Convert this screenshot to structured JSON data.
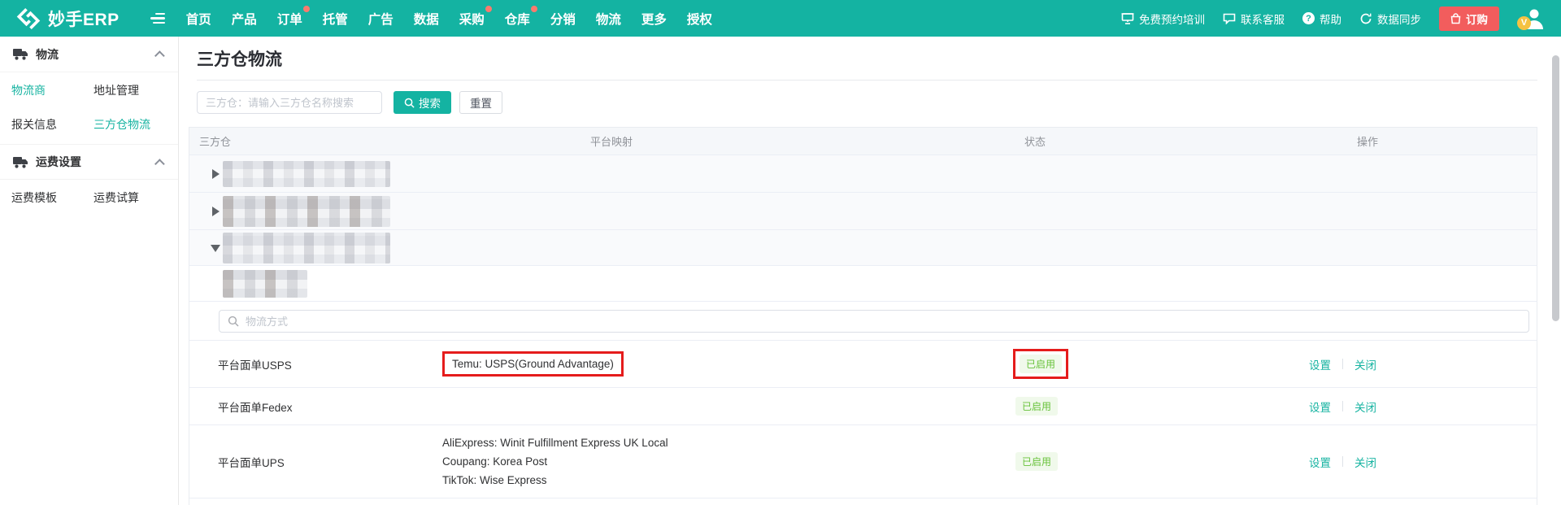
{
  "brand": {
    "name": "妙手ERP"
  },
  "topnav": {
    "items": [
      {
        "label": "首页",
        "dot": false
      },
      {
        "label": "产品",
        "dot": false
      },
      {
        "label": "订单",
        "dot": true
      },
      {
        "label": "托管",
        "dot": false
      },
      {
        "label": "广告",
        "dot": false
      },
      {
        "label": "数据",
        "dot": false
      },
      {
        "label": "采购",
        "dot": true
      },
      {
        "label": "仓库",
        "dot": true
      },
      {
        "label": "分销",
        "dot": false
      },
      {
        "label": "物流",
        "dot": false
      },
      {
        "label": "更多",
        "dot": false
      },
      {
        "label": "授权",
        "dot": false
      }
    ]
  },
  "header_right": {
    "training": "免费预约培训",
    "support": "联系客服",
    "help": "帮助",
    "sync": "数据同步",
    "order": "订购",
    "avatar_badge": "V"
  },
  "sidebar": {
    "sections": [
      {
        "title": "物流",
        "items": [
          {
            "label": "物流商",
            "active": true
          },
          {
            "label": "地址管理",
            "active": false
          },
          {
            "label": "报关信息",
            "active": false
          },
          {
            "label": "三方仓物流",
            "active": true
          }
        ]
      },
      {
        "title": "运费设置",
        "items": [
          {
            "label": "运费模板",
            "active": false
          },
          {
            "label": "运费试算",
            "active": false
          }
        ]
      }
    ]
  },
  "main": {
    "title": "三方仓物流",
    "filter": {
      "placeholder": "三方仓：请输入三方仓名称搜索",
      "search": "搜索",
      "reset": "重置"
    },
    "table": {
      "columns": [
        "三方仓",
        "平台映射",
        "状态",
        "操作"
      ],
      "inner_search_placeholder": "物流方式",
      "rows": [
        {
          "name": "平台面单USPS",
          "mappings": [
            "Temu: USPS(Ground Advantage)"
          ],
          "status": "已启用",
          "actions": [
            "设置",
            "关闭"
          ],
          "highlighted": true
        },
        {
          "name": "平台面单Fedex",
          "mappings": [],
          "status": "已启用",
          "actions": [
            "设置",
            "关闭"
          ],
          "highlighted": false
        },
        {
          "name": "平台面单UPS",
          "mappings": [
            "AliExpress: Winit Fulfillment Express UK Local",
            "Coupang: Korea Post",
            "TikTok: Wise Express"
          ],
          "status": "已启用",
          "actions": [
            "设置",
            "关闭"
          ],
          "highlighted": false
        }
      ]
    }
  },
  "colors": {
    "brand_teal": "#14b3a2",
    "active_link_teal": "#16b3a1",
    "badge_green_text": "#67c23a",
    "badge_green_bg": "#f0f9eb",
    "highlight_red": "#e51c1c",
    "order_button_red": "#f25d5d",
    "notification_dot": "#fb7a6e",
    "avatar_badge_yellow": "#f5c242"
  }
}
